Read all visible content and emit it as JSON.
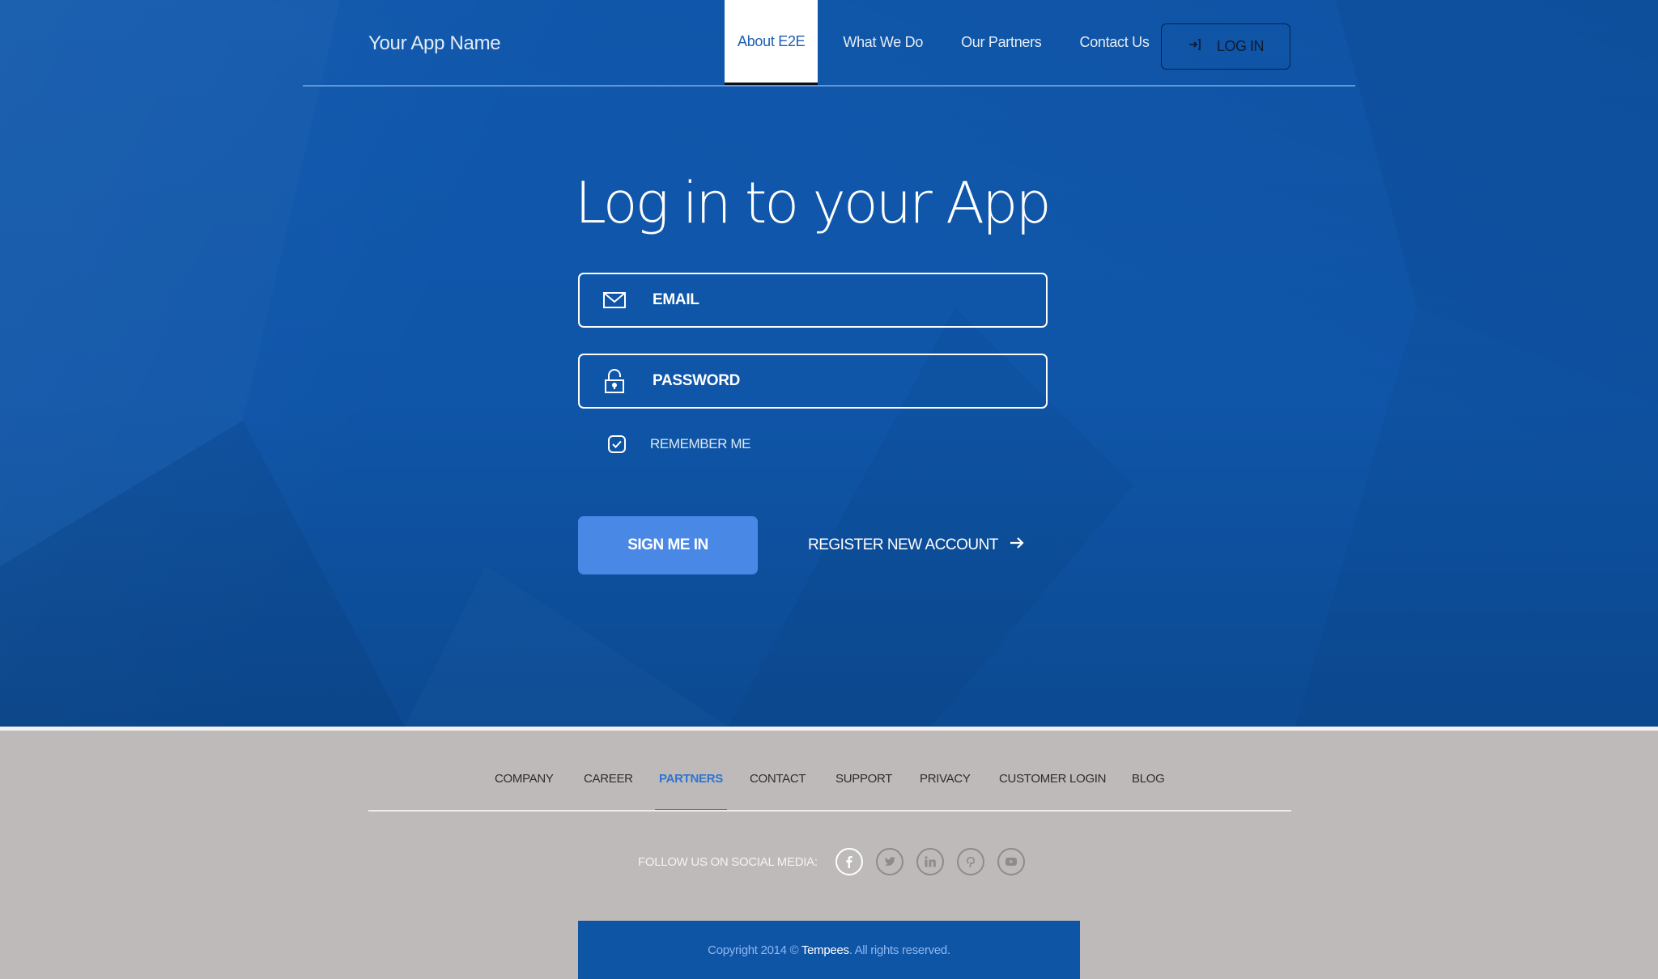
{
  "header": {
    "app_name": "Your App Name",
    "nav": [
      {
        "label": "About E2E",
        "active": true
      },
      {
        "label": "What We Do",
        "active": false
      },
      {
        "label": "Our Partners",
        "active": false
      },
      {
        "label": "Contact Us",
        "active": false
      }
    ],
    "login_button": {
      "label": "LOG IN",
      "icon": "sign-in-icon"
    }
  },
  "login_form": {
    "title": "Log in to your App",
    "email": {
      "placeholder": "EMAIL",
      "value": "",
      "icon": "envelope-icon"
    },
    "password": {
      "placeholder": "PASSWORD",
      "value": "",
      "icon": "unlock-icon"
    },
    "remember_me": {
      "label": "REMEMBER ME",
      "checked": true
    },
    "submit_label": "SIGN ME IN",
    "register_label": "REGISTER NEW ACCOUNT"
  },
  "footer": {
    "links": [
      {
        "label": "COMPANY",
        "active": false
      },
      {
        "label": "CAREER",
        "active": false
      },
      {
        "label": "PARTNERS",
        "active": true
      },
      {
        "label": "CONTACT",
        "active": false
      },
      {
        "label": "SUPPORT",
        "active": false
      },
      {
        "label": "PRIVACY",
        "active": false
      },
      {
        "label": "CUSTOMER LOGIN",
        "active": false
      },
      {
        "label": "BLOG",
        "active": false
      }
    ],
    "social_label": "FOLLOW US ON SOCIAL MEDIA:",
    "social": [
      {
        "name": "facebook",
        "icon": "facebook-icon",
        "active": true
      },
      {
        "name": "twitter",
        "icon": "twitter-icon",
        "active": false
      },
      {
        "name": "linkedin",
        "icon": "linkedin-icon",
        "active": false
      },
      {
        "name": "pinterest",
        "icon": "pinterest-icon",
        "active": false
      },
      {
        "name": "youtube",
        "icon": "youtube-icon",
        "active": false
      }
    ],
    "copyright": {
      "prefix": "Copyright 2014 © ",
      "brand": "Tempees",
      "suffix": ". All rights reserved."
    }
  },
  "colors": {
    "hero_blue": "#0f55a8",
    "accent_blue": "#4a88e6",
    "footer_gray": "#bebab9",
    "active_link": "#2f74d0"
  }
}
